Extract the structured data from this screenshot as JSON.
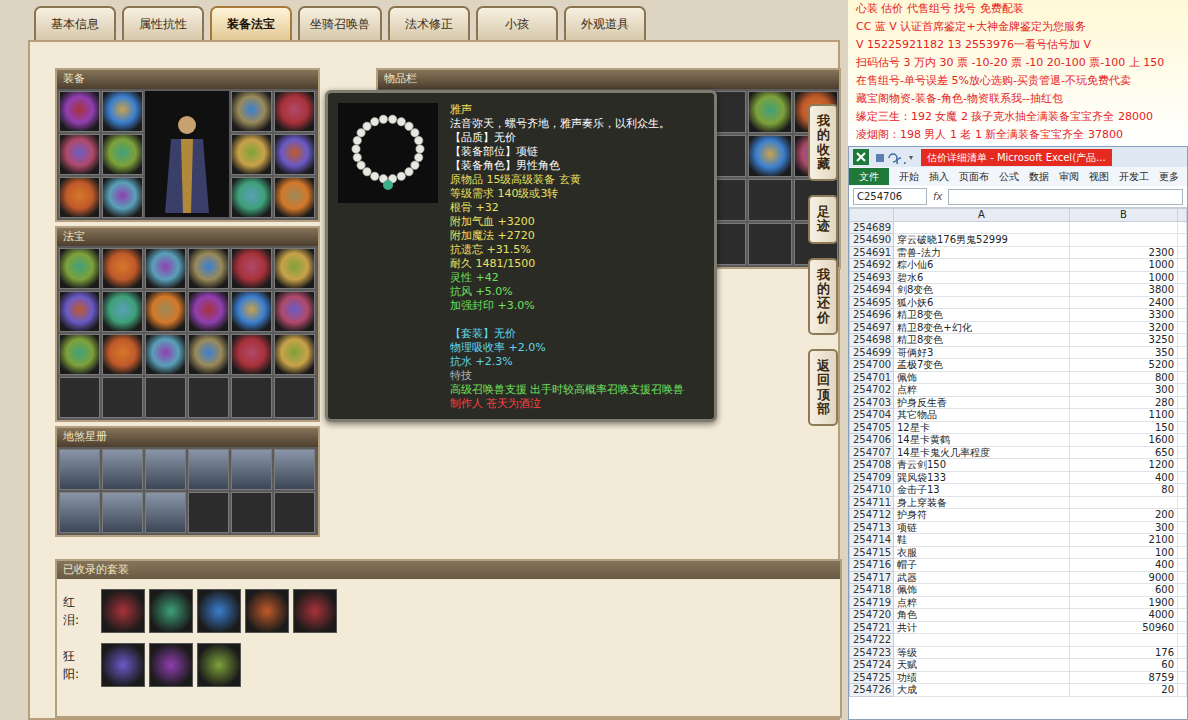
{
  "tabs": [
    {
      "label": "基本信息",
      "selected": false
    },
    {
      "label": "属性抗性",
      "selected": false
    },
    {
      "label": "装备法宝",
      "selected": true
    },
    {
      "label": "坐骑召唤兽",
      "selected": false
    },
    {
      "label": "法术修正",
      "selected": false
    },
    {
      "label": "小孩",
      "selected": false
    },
    {
      "label": "外观道具",
      "selected": false
    }
  ],
  "equip": {
    "title": "装备",
    "slots": [
      true,
      true,
      true,
      true,
      true,
      true,
      true,
      true,
      true,
      true,
      true,
      true
    ]
  },
  "fabao": {
    "title": "法宝",
    "slots": [
      true,
      true,
      true,
      true,
      true,
      true,
      true,
      true,
      true,
      true,
      true,
      true,
      true,
      true,
      true,
      true,
      true,
      true,
      false,
      false,
      false,
      false,
      false,
      false
    ]
  },
  "star_book": {
    "title": "地煞星册",
    "slots": [
      true,
      true,
      true,
      true,
      true,
      true,
      true,
      true,
      true,
      false,
      false,
      false
    ]
  },
  "inventory": {
    "title": "物品栏",
    "slots": [
      false,
      false,
      false,
      false,
      false,
      false,
      false,
      false,
      true,
      true,
      false,
      false,
      false,
      false,
      false,
      false,
      false,
      false,
      true,
      true,
      false,
      false,
      false,
      false,
      false,
      false,
      false,
      false,
      false,
      false,
      false,
      false,
      false,
      false,
      false,
      false,
      false,
      false,
      false,
      false
    ]
  },
  "tooltip": {
    "title": "雅声",
    "title_color": "#f0e060",
    "lines": [
      {
        "text": "法音弥天，螺号齐地，雅声奏乐，以利众生。",
        "color": "#ffffff"
      },
      {
        "text": "【品质】无价",
        "color": "#ffffff"
      },
      {
        "text": "【装备部位】项链",
        "color": "#ffffff"
      },
      {
        "text": "【装备角色】男性角色",
        "color": "#ffffff"
      },
      {
        "text": "原物品 15级高级装备 玄黄",
        "color": "#e8e060"
      },
      {
        "text": "等级需求 140级或3转",
        "color": "#e8e060"
      },
      {
        "text": "根骨 +32",
        "color": "#e8e060"
      },
      {
        "text": "附加气血 +3200",
        "color": "#e8e060"
      },
      {
        "text": "附加魔法 +2720",
        "color": "#e8e060"
      },
      {
        "text": "抗遗忘 +31.5%",
        "color": "#e8e060"
      },
      {
        "text": "耐久 1481/1500",
        "color": "#e8e060"
      },
      {
        "text": "灵性 +42",
        "color": "#6ee05a"
      },
      {
        "text": "抗风 +5.0%",
        "color": "#6ee05a"
      },
      {
        "text": "加强封印 +3.0%",
        "color": "#6ee05a"
      }
    ],
    "suit_lines": [
      {
        "text": "【套装】无价",
        "color": "#5fd8e8"
      },
      {
        "text": "物理吸收率 +2.0%",
        "color": "#5fd8e8"
      },
      {
        "text": "抗水 +2.3%",
        "color": "#5fd8e8"
      },
      {
        "text": "特技",
        "color": "#b0b0b0"
      },
      {
        "text": "高级召唤兽支援 出手时较高概率召唤支援召唤兽",
        "color": "#6ee05a"
      },
      {
        "text": "制作人 苍天为酒泣",
        "color": "#ff4040"
      }
    ]
  },
  "side_buttons": [
    "我的收藏",
    "足迹",
    "我的还价",
    "返回顶部"
  ],
  "suits": {
    "title": "已收录的套装",
    "groups": [
      {
        "name": "红泪:",
        "pieces": 5
      },
      {
        "name": "狂阳:",
        "pieces": 3
      }
    ]
  },
  "ad": [
    "心装 估价 代售组号 找号 免费配装",
    "CC 蓝 V 认证首席鉴定+大神金牌鉴定为您服务",
    "V 15225921182     13 2553976一看号估号加 V",
    "扫码估号 3 万内 30 票 -10-20 票 -10 20-100 票-100 上 150",
    "在售组号-单号误差 5%放心选购-买贵管退-不玩免费代卖",
    "藏宝阁物资-装备-角色-物资联系我--抽红包",
    "缘定三生：192 女魔 2 孩子克水抽全满装备宝宝齐全 28000",
    "凌烟阁：198 男人 1 老 1 新全满装备宝宝齐全 37800"
  ],
  "excel": {
    "title": "估价详细清单 - Microsoft Excel(产品...",
    "ribbon": [
      "文件",
      "开始",
      "插入",
      "页面布",
      "公式",
      "数据",
      "审阅",
      "视图",
      "开发工",
      "更多"
    ],
    "name_box": "C254706",
    "fx": "fx",
    "columns": [
      "A",
      "B"
    ],
    "rows": [
      [
        "254689",
        "",
        ""
      ],
      [
        "254690",
        "穿云破晓176男鬼52999",
        ""
      ],
      [
        "254691",
        "雷兽-法力",
        "2300"
      ],
      [
        "254692",
        "粽小仙6",
        "1000"
      ],
      [
        "254693",
        "碧水6",
        "1000"
      ],
      [
        "254694",
        "剑8变色",
        "3800"
      ],
      [
        "254695",
        "狐小妖6",
        "2400"
      ],
      [
        "254696",
        "精卫8变色",
        "3300"
      ],
      [
        "254697",
        "精卫8变色+幻化",
        "3200"
      ],
      [
        "254698",
        "精卫8变色",
        "3250"
      ],
      [
        "254699",
        "哥俩好3",
        "350"
      ],
      [
        "254700",
        "孟极7变色",
        "5200"
      ],
      [
        "254701",
        "佩饰",
        "800"
      ],
      [
        "254702",
        "点粹",
        "300"
      ],
      [
        "254703",
        "护身反生香",
        "280"
      ],
      [
        "254704",
        "其它物品",
        "1100"
      ],
      [
        "254705",
        "12星卡",
        "150"
      ],
      [
        "254706",
        "14星卡黄鹤",
        "1600"
      ],
      [
        "254707",
        "14星卡鬼火几率程度",
        "650"
      ],
      [
        "254708",
        "青云剑150",
        "1200"
      ],
      [
        "254709",
        "巽风袋133",
        "400"
      ],
      [
        "254710",
        "金击子13",
        "80"
      ],
      [
        "254711",
        "身上穿装备",
        ""
      ],
      [
        "254712",
        "护身符",
        "200"
      ],
      [
        "254713",
        "项链",
        "300"
      ],
      [
        "254714",
        "鞋",
        "2100"
      ],
      [
        "254715",
        "衣服",
        "100"
      ],
      [
        "254716",
        "帽子",
        "400"
      ],
      [
        "254717",
        "武器",
        "9000"
      ],
      [
        "254718",
        "佩饰",
        "600"
      ],
      [
        "254719",
        "点粹",
        "1900"
      ],
      [
        "254720",
        "角色",
        "4000"
      ],
      [
        "254721",
        "共计",
        "50960"
      ],
      [
        "254722",
        "",
        ""
      ],
      [
        "254723",
        "等级",
        "176"
      ],
      [
        "254724",
        "天赋",
        "60"
      ],
      [
        "254725",
        "功绩",
        "8759"
      ],
      [
        "254726",
        "大成",
        "20"
      ]
    ]
  }
}
